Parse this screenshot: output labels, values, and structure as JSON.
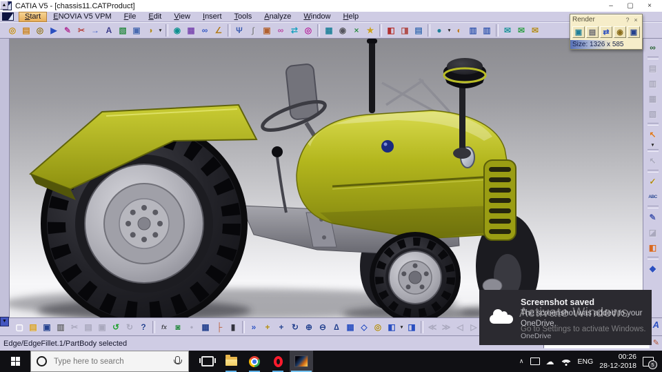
{
  "window": {
    "title": "CATIA V5 - [chassis11.CATProduct]",
    "controls": {
      "minimize": "–",
      "restore": "▢",
      "close": "×"
    }
  },
  "menu": {
    "items": [
      {
        "n": "menu-item-start",
        "label": "Start",
        "active": true
      },
      {
        "n": "menu-item-enovia-v5-vpm",
        "label": "ENOVIA V5 VPM"
      },
      {
        "n": "menu-item-file",
        "label": "File"
      },
      {
        "n": "menu-item-edit",
        "label": "Edit"
      },
      {
        "n": "menu-item-view",
        "label": "View"
      },
      {
        "n": "menu-item-insert",
        "label": "Insert"
      },
      {
        "n": "menu-item-tools",
        "label": "Tools"
      },
      {
        "n": "menu-item-analyze",
        "label": "Analyze"
      },
      {
        "n": "menu-item-window",
        "label": "Window"
      },
      {
        "n": "menu-item-help",
        "label": "Help"
      }
    ]
  },
  "toolbar_top": {
    "icons": [
      {
        "n": "update-icon",
        "g": "◎",
        "c": "#c18a10"
      },
      {
        "n": "catalog-icon",
        "g": "▤",
        "c": "#c87f1a"
      },
      {
        "n": "gears-icon",
        "g": "◎",
        "c": "#8a6d1a"
      },
      {
        "n": "export-doc-icon",
        "g": "▶",
        "c": "#2b4fc0"
      },
      {
        "n": "doc-edit-icon",
        "g": "✎",
        "c": "#b03a9a"
      },
      {
        "n": "cut-link-icon",
        "g": "✂",
        "c": "#b04040"
      },
      {
        "n": "import-doc-icon",
        "g": "→",
        "c": "#2b4fc0"
      },
      {
        "n": "text-report-icon",
        "g": "A",
        "c": "#3a3a8a"
      },
      {
        "n": "layers-icon",
        "g": "▧",
        "c": "#2f8a4a"
      },
      {
        "n": "window-link-icon",
        "g": "▣",
        "c": "#4a6ab0"
      },
      {
        "n": "clock-gear-icon",
        "g": "◑",
        "c": "#b08a20"
      },
      {
        "n": "flyout-arrow-icon",
        "g": "▾",
        "cls": "dd"
      },
      {
        "sep": true
      },
      {
        "n": "sketch-tracer-icon",
        "g": "◉",
        "c": "#0e8f8f"
      },
      {
        "n": "photo-box-icon",
        "g": "▦",
        "c": "#7a4ab0"
      },
      {
        "n": "binoculars-icon",
        "g": "∞",
        "c": "#2b4fc0"
      },
      {
        "n": "angle-icon",
        "g": "∠",
        "c": "#b07a20"
      },
      {
        "sep": true
      },
      {
        "n": "anchor-icon",
        "g": "Ψ",
        "c": "#3a5ab0"
      },
      {
        "n": "paperclip-icon",
        "g": "∫",
        "c": "#8a8a92"
      },
      {
        "n": "image-frame-icon",
        "g": "▣",
        "c": "#b06030"
      },
      {
        "n": "link-chain-icon",
        "g": "∞",
        "c": "#b040a0"
      },
      {
        "n": "sync-icon",
        "g": "⇄",
        "c": "#20a0c0"
      },
      {
        "n": "color-gear-icon",
        "g": "◎",
        "c": "#b0209a"
      },
      {
        "sep": true
      },
      {
        "n": "render-box-icon",
        "g": "▦",
        "c": "#20809a"
      },
      {
        "n": "camera-icon",
        "g": "◉",
        "c": "#55555f"
      },
      {
        "n": "axis-cross-icon",
        "g": "×",
        "c": "#2f8a4a"
      },
      {
        "n": "star-icon",
        "g": "★",
        "c": "#c8a020"
      },
      {
        "sep": true
      },
      {
        "n": "red-cube-icon",
        "g": "◧",
        "c": "#b03030"
      },
      {
        "n": "cube-stack-icon",
        "g": "◨",
        "c": "#b05050"
      },
      {
        "n": "list-doc-icon",
        "g": "▤",
        "c": "#3a6ab0"
      },
      {
        "sep": true
      },
      {
        "n": "video-camera-icon",
        "g": "●",
        "c": "#20809a"
      },
      {
        "n": "flyout-arrow-icon",
        "g": "▾",
        "cls": "dd"
      },
      {
        "n": "palette-icon",
        "g": "◐",
        "c": "#c07a20"
      },
      {
        "n": "doc-view-icon",
        "g": "▥",
        "c": "#3a5ab0"
      },
      {
        "n": "doc-view2-icon",
        "g": "▥",
        "c": "#3a5ab0"
      },
      {
        "sep": true
      },
      {
        "n": "mail-open-icon",
        "g": "✉",
        "c": "#20909a"
      },
      {
        "n": "mail-forward-icon",
        "g": "✉",
        "c": "#2f9a4a"
      },
      {
        "n": "mail-sync-icon",
        "g": "✉",
        "c": "#b08a20"
      }
    ]
  },
  "right_toolbar": {
    "icons": [
      {
        "n": "render-shooting-icon",
        "g": "∞",
        "c": "#205a30"
      },
      {
        "sep": true
      },
      {
        "n": "apply-material-icon",
        "g": "▤",
        "c": "#a9a8bd",
        "grayed": true
      },
      {
        "n": "material-catalog-icon",
        "g": "▥",
        "c": "#a9a8bd",
        "grayed": true
      },
      {
        "n": "texture-icon",
        "g": "▦",
        "c": "#a9a8bd",
        "grayed": true
      },
      {
        "n": "mapping-icon",
        "g": "▧",
        "c": "#a9a8bd",
        "grayed": true
      },
      {
        "sep": true
      },
      {
        "n": "select-arrow-icon",
        "g": "↖",
        "c": "#e07818"
      },
      {
        "n": "flyout-arrow-icon",
        "g": "▾",
        "cls": "dd"
      },
      {
        "sep": true
      },
      {
        "n": "selection-sets-icon",
        "g": "↖",
        "c": "#a9a8bd",
        "grayed": true
      },
      {
        "sep": true
      },
      {
        "n": "measure-between-icon",
        "g": "✓",
        "c": "#b08a10"
      },
      {
        "n": "measure-item-icon",
        "g": "ABC",
        "c": "#24408e",
        "cls": "small"
      },
      {
        "sep": true
      },
      {
        "n": "annotations-icon",
        "g": "✎",
        "c": "#4a5ab0"
      },
      {
        "n": "section-prism-icon",
        "g": "◪",
        "c": "#a9a8bd",
        "grayed": true
      },
      {
        "n": "paint-bucket-icon",
        "g": "◧",
        "c": "#d86820"
      },
      {
        "sep": true
      },
      {
        "n": "eraser-icon",
        "g": "◆",
        "c": "#2b4fc0"
      }
    ]
  },
  "toolbar_bottom": {
    "nav_down": "▼",
    "annotation": "A",
    "icons": [
      {
        "n": "new-doc-icon",
        "g": "▢",
        "c": "#fafafd"
      },
      {
        "n": "open-icon",
        "g": "▤",
        "c": "#d8a020"
      },
      {
        "n": "save-icon",
        "g": "▣",
        "c": "#24408e"
      },
      {
        "n": "print-icon",
        "g": "▥",
        "c": "#6a6a72"
      },
      {
        "n": "cut-icon",
        "g": "✂",
        "c": "#a9a8bd",
        "grayed": true
      },
      {
        "n": "copy-icon",
        "g": "▤",
        "c": "#a9a8bd",
        "grayed": true
      },
      {
        "n": "paste-icon",
        "g": "▣",
        "c": "#a9a8bd",
        "grayed": true
      },
      {
        "n": "undo-icon",
        "g": "↺",
        "c": "#1f9d2f"
      },
      {
        "n": "redo-icon",
        "g": "↻",
        "c": "#a9a8bd",
        "grayed": true
      },
      {
        "n": "whats-this-icon",
        "g": "?",
        "c": "#24408e"
      },
      {
        "sep": true
      },
      {
        "n": "formula-icon",
        "g": "fx",
        "c": "#444450",
        "cls": "small2"
      },
      {
        "n": "comment-icon",
        "g": "◙",
        "c": "#2f8a4a"
      },
      {
        "n": "constraint-dot-icon",
        "g": "•",
        "c": "#a9a8bd",
        "grayed": true
      },
      {
        "n": "design-table-icon",
        "g": "▦",
        "c": "#24408e"
      },
      {
        "n": "relations-icon",
        "g": "├",
        "c": "#b05030"
      },
      {
        "n": "lock-icon",
        "g": "▮",
        "c": "#33333e"
      },
      {
        "sep": true
      },
      {
        "n": "fly-mode-icon",
        "g": "»",
        "c": "#2b4fc0"
      },
      {
        "n": "fit-all-icon",
        "g": "+",
        "c": "#b08a10"
      },
      {
        "n": "pan-icon",
        "g": "+",
        "c": "#24408e"
      },
      {
        "n": "rotate-icon",
        "g": "↻",
        "c": "#24408e"
      },
      {
        "n": "zoom-in-icon",
        "g": "⊕",
        "c": "#24408e"
      },
      {
        "n": "zoom-out-icon",
        "g": "⊖",
        "c": "#24408e"
      },
      {
        "n": "normal-view-icon",
        "g": "∆",
        "c": "#24408e"
      },
      {
        "n": "multi-view-icon",
        "g": "▦",
        "c": "#2b4fc0"
      },
      {
        "n": "iso-view-icon",
        "g": "◇",
        "c": "#2b4fc0"
      },
      {
        "n": "shaded-view-icon",
        "g": "◎",
        "c": "#b08a10"
      },
      {
        "n": "render-style-icon",
        "g": "◧",
        "c": "#2b4fc0"
      },
      {
        "n": "flyout-arrow-icon",
        "g": "▾",
        "cls": "dd"
      },
      {
        "n": "render-style2-icon",
        "g": "◨",
        "c": "#2b4fc0"
      },
      {
        "sep": true
      },
      {
        "n": "turn-head-icon",
        "g": "≪",
        "c": "#a9a8bd",
        "grayed": true
      },
      {
        "n": "fly-forward-icon",
        "g": "≫",
        "c": "#a9a8bd",
        "grayed": true
      },
      {
        "n": "walk-icon",
        "g": "◁",
        "c": "#a9a8bd",
        "grayed": true
      },
      {
        "n": "examine-icon",
        "g": "▷",
        "c": "#a9a8bd",
        "grayed": true
      }
    ]
  },
  "leftstrip": {
    "nav_up": "▲"
  },
  "render_dialog": {
    "title": "Render",
    "help": "?",
    "close": "×",
    "size_label": "Size: 1326 x 585",
    "buttons": [
      {
        "n": "render-quick-icon",
        "g": "▣",
        "c": "#20809a"
      },
      {
        "n": "render-options-icon",
        "g": "▤",
        "c": "#6a6a72"
      },
      {
        "n": "render-capture-icon",
        "g": "⇄",
        "c": "#2b4fc0"
      },
      {
        "n": "render-camera-icon",
        "g": "◉",
        "c": "#8a6d1a"
      },
      {
        "n": "render-save-icon",
        "g": "▣",
        "c": "#24408e"
      }
    ]
  },
  "viewport": {
    "watermark_line1": "Activate Windows",
    "watermark_line2": "Go to Settings to activate Windows."
  },
  "notification": {
    "title": "Screenshot saved",
    "body_line1": "The screenshot was added to your",
    "body_line2": "OneDrive.",
    "app": "OneDrive"
  },
  "statusbar": {
    "message": "Edge/EdgeFillet.1/PartBody selected",
    "command_value": ""
  },
  "taskbar": {
    "search_placeholder": "Type here to search",
    "tray": {
      "chevron": "∧",
      "language": "ENG",
      "time": "00:26",
      "date": "28-12-2018",
      "badge": "5"
    }
  }
}
